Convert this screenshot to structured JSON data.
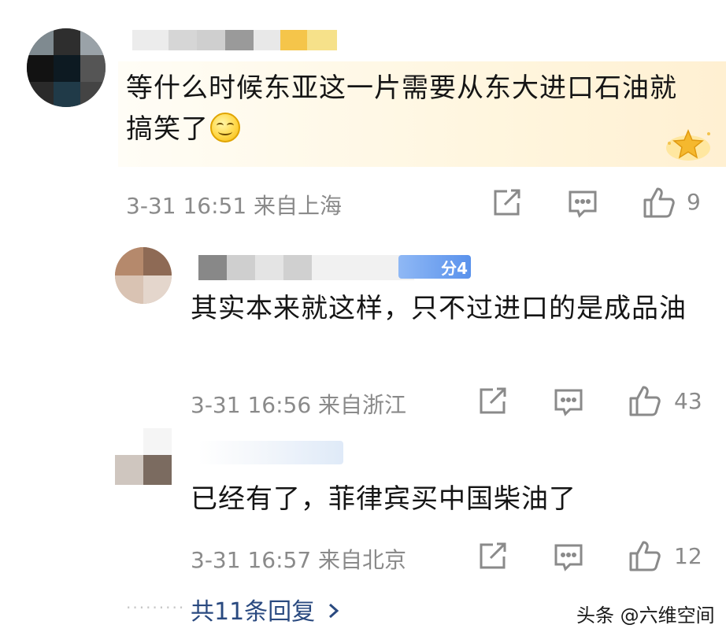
{
  "comments": [
    {
      "text": "等什么时候东亚这一片需要从东大进口石油就搞笑了",
      "time_location": "3-31 16:51 来自上海",
      "likes": "9"
    },
    {
      "text": "其实本来就这样，只不过进口的是成品油",
      "time_location": "3-31 16:56 来自浙江",
      "likes": "43",
      "fan_badge": "分4"
    },
    {
      "text": "已经有了，菲律宾买中国柴油了",
      "time_location": "3-31 16:57 来自北京",
      "likes": "12"
    }
  ],
  "more_replies": "共11条回复",
  "watermark": "头条 @六维空间",
  "icons": [
    "share-icon",
    "comment-icon",
    "like-icon",
    "chevron-right-icon",
    "vip-badge-icon",
    "emoji-icon"
  ]
}
